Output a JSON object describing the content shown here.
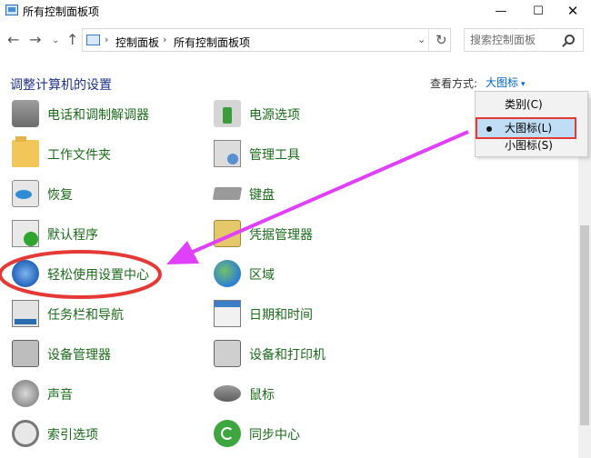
{
  "window": {
    "title": "所有控制面板项"
  },
  "window_controls": {
    "minimize": "—",
    "maximize": "☐",
    "close": "✕"
  },
  "nav": {
    "back": "←",
    "forward": "→",
    "recent": "⌄",
    "up": "↑"
  },
  "address": {
    "crumbs": [
      "控制面板",
      "所有控制面板项"
    ],
    "separator": "›",
    "dropdown": "⌄",
    "refresh": "↻"
  },
  "search": {
    "placeholder": "搜索控制面板"
  },
  "header": {
    "title": "调整计算机的设置",
    "view_by_label": "查看方式:",
    "view_by_value": "大图标",
    "view_by_arrow": "▾"
  },
  "view_menu": {
    "items": [
      {
        "label": "类别(C)",
        "selected": false
      },
      {
        "label": "大图标(L)",
        "selected": true
      },
      {
        "label": "小图标(S)",
        "selected": false
      }
    ]
  },
  "items_left": [
    {
      "label": "电话和调制解调器",
      "icon": "phone-modem-icon"
    },
    {
      "label": "工作文件夹",
      "icon": "work-folders-icon"
    },
    {
      "label": "恢复",
      "icon": "recovery-icon"
    },
    {
      "label": "默认程序",
      "icon": "default-programs-icon"
    },
    {
      "label": "轻松使用设置中心",
      "icon": "ease-of-access-icon"
    },
    {
      "label": "任务栏和导航",
      "icon": "taskbar-icon"
    },
    {
      "label": "设备管理器",
      "icon": "device-manager-icon"
    },
    {
      "label": "声音",
      "icon": "sound-icon"
    },
    {
      "label": "索引选项",
      "icon": "indexing-icon"
    }
  ],
  "items_right": [
    {
      "label": "电源选项",
      "icon": "power-options-icon"
    },
    {
      "label": "管理工具",
      "icon": "admin-tools-icon"
    },
    {
      "label": "键盘",
      "icon": "keyboard-icon"
    },
    {
      "label": "凭据管理器",
      "icon": "credential-manager-icon"
    },
    {
      "label": "区域",
      "icon": "region-icon"
    },
    {
      "label": "日期和时间",
      "icon": "date-time-icon"
    },
    {
      "label": "设备和打印机",
      "icon": "devices-printers-icon"
    },
    {
      "label": "鼠标",
      "icon": "mouse-icon"
    },
    {
      "label": "同步中心",
      "icon": "sync-center-icon"
    }
  ],
  "colors": {
    "item_label": "#1a6b1a",
    "title": "#1e3287",
    "annotation_arrow": "#e040fb",
    "annotation_highlight": "#e53935",
    "menu_selected": "#bfddf5"
  }
}
